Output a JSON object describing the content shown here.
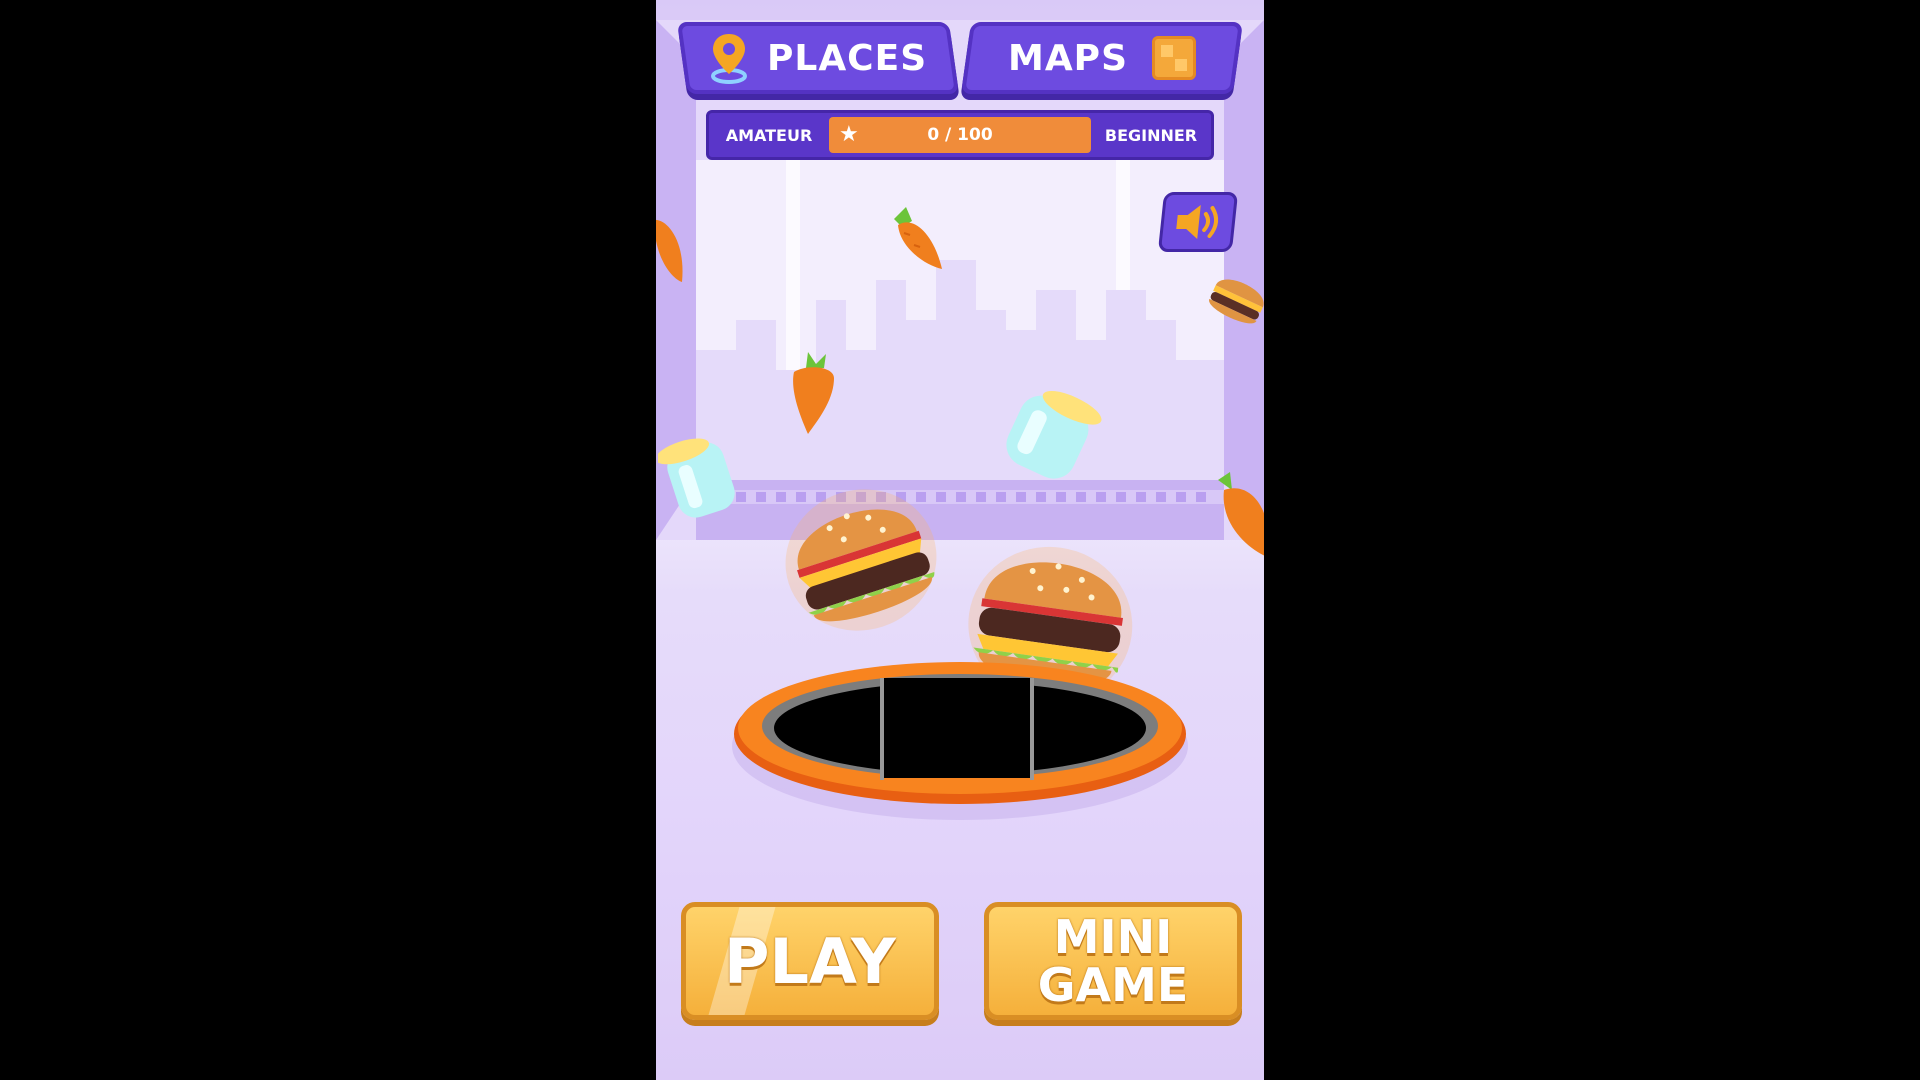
{
  "nav": {
    "places_label": "PLACES",
    "maps_label": "MAPS",
    "places_icon": "map-pin-icon",
    "maps_icon": "map-icon"
  },
  "level": {
    "current_rank": "AMATEUR",
    "next_rank": "BEGINNER",
    "progress_text": "0 / 100",
    "progress_value": 0,
    "progress_max": 100,
    "icon": "star-icon"
  },
  "sound": {
    "icon": "speaker-icon",
    "state": "on"
  },
  "buttons": {
    "play_label": "PLAY",
    "mini_line1": "MINI",
    "mini_line2": "GAME"
  },
  "colors": {
    "nav_purple": "#6d4be0",
    "progress_orange": "#f08c3a",
    "button_yellow": "#f5b03b",
    "hole_ring": "#f07a1a"
  }
}
